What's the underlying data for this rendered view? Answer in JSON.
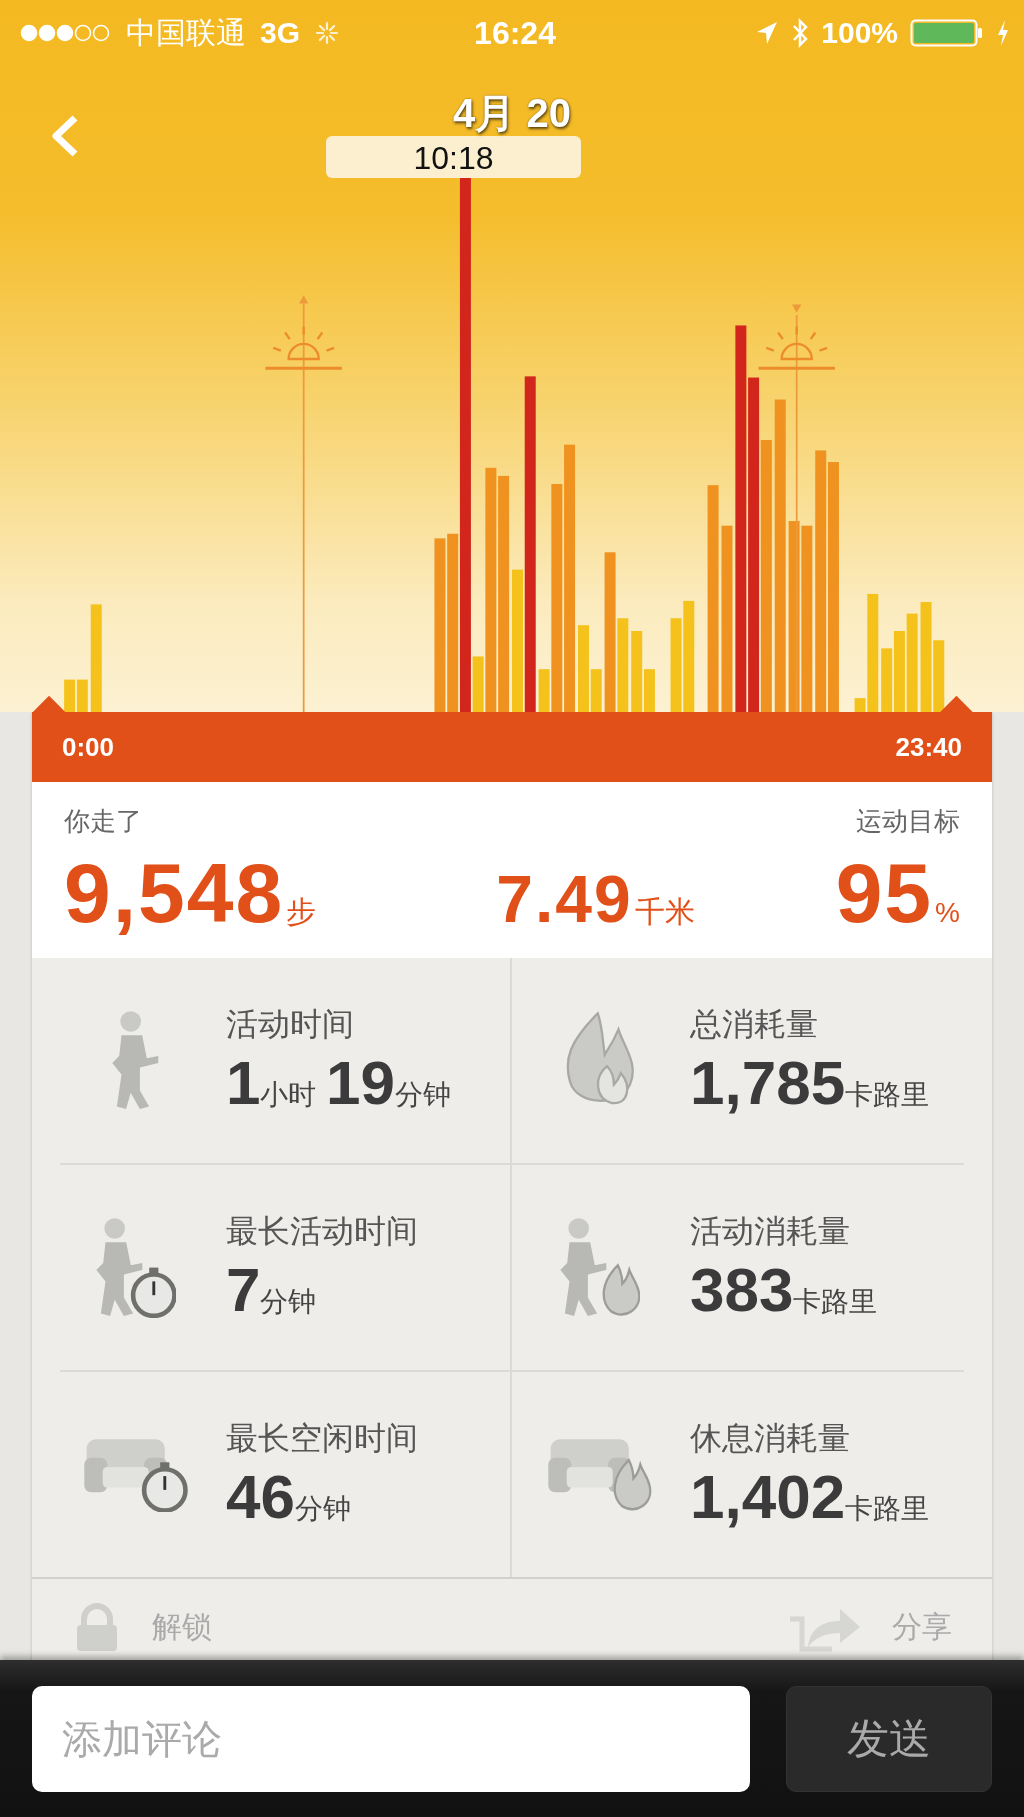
{
  "status_bar": {
    "carrier": "中国联通",
    "network": "3G",
    "time": "16:24",
    "battery": "100%"
  },
  "header": {
    "title": "4月 20"
  },
  "chart": {
    "tooltip": "10:18",
    "start_label": "0:00",
    "end_label": "23:40"
  },
  "summary": {
    "steps_label": "你走了",
    "steps": "9,548",
    "steps_unit": "步",
    "distance": "7.49",
    "distance_unit": "千米",
    "goal_label": "运动目标",
    "goal": "95",
    "goal_unit": "%"
  },
  "stats": [
    {
      "kind": "activity",
      "label": "活动时间",
      "parts": [
        {
          "number": "1",
          "unit": "小时"
        },
        {
          "number": "19",
          "unit": "分钟"
        }
      ]
    },
    {
      "kind": "total_burn",
      "label": "总消耗量",
      "parts": [
        {
          "number": "1,785",
          "unit": "卡路里"
        }
      ]
    },
    {
      "kind": "longest_active",
      "label": "最长活动时间",
      "parts": [
        {
          "number": "7",
          "unit": "分钟"
        }
      ]
    },
    {
      "kind": "active_burn",
      "label": "活动消耗量",
      "parts": [
        {
          "number": "383",
          "unit": "卡路里"
        }
      ]
    },
    {
      "kind": "longest_idle",
      "label": "最长空闲时间",
      "parts": [
        {
          "number": "46",
          "unit": "分钟"
        }
      ]
    },
    {
      "kind": "rest_burn",
      "label": "休息消耗量",
      "parts": [
        {
          "number": "1,402",
          "unit": "卡路里"
        }
      ]
    }
  ],
  "actions": [
    {
      "kind": "lock",
      "label": "解锁"
    },
    {
      "kind": "share",
      "label": "分享"
    }
  ],
  "comment": {
    "placeholder": "添加评论",
    "send": "发送"
  }
}
